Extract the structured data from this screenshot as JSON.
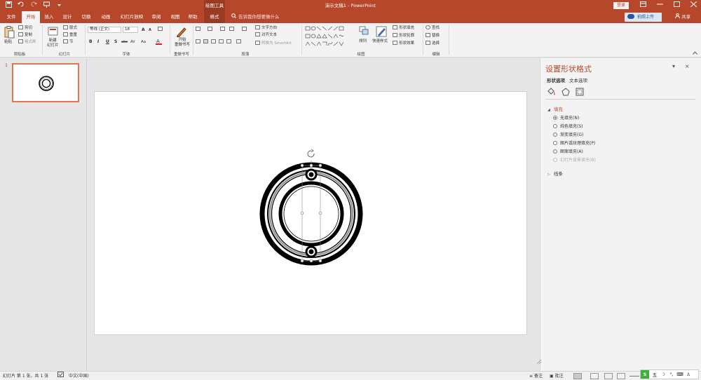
{
  "title_bar": {
    "document_title": "演示文稿1  -  PowerPoint",
    "context_group": "绘图工具",
    "login_button": "登录",
    "qat_icons": [
      "save-icon",
      "undo-icon",
      "redo-icon",
      "start-from-beginning-icon",
      "customize-qat-icon"
    ],
    "window_controls": [
      "ribbon-display-icon",
      "minimize-icon",
      "restore-icon",
      "close-icon"
    ]
  },
  "tabs": [
    {
      "label": "文件"
    },
    {
      "label": "开始"
    },
    {
      "label": "插入"
    },
    {
      "label": "设计"
    },
    {
      "label": "切换"
    },
    {
      "label": "动画"
    },
    {
      "label": "幻灯片放映"
    },
    {
      "label": "审阅"
    },
    {
      "label": "视图"
    },
    {
      "label": "帮助"
    },
    {
      "label": "格式"
    }
  ],
  "tell_me": "告诉我你想要做什么",
  "upload_button": "拍照上传",
  "share_button": "共享",
  "ribbon": {
    "clipboard": {
      "paste": "粘贴",
      "cut": "剪切",
      "copy": "复制",
      "format_painter": "格式刷",
      "label": "剪贴板"
    },
    "slides": {
      "new_slide": "新建\n幻灯片",
      "layout": "版式",
      "reset": "重置",
      "section": "节",
      "label": "幻灯片"
    },
    "font": {
      "font_name": "等线 (正文)",
      "font_size": "18",
      "label": "字体",
      "bold": "B",
      "italic": "I",
      "underline": "U",
      "shadow": "S",
      "strikethrough": "abc",
      "spacing": "AV",
      "case": "Aa",
      "grow": "A",
      "shrink": "A"
    },
    "painter": {
      "label_btn": "开始\n重做书写",
      "label": "重做书写"
    },
    "paragraph": {
      "text_direction": "文字方向",
      "align_text": "对齐文本",
      "smartart": "转换为 SmartArt",
      "label": "段落"
    },
    "drawing": {
      "arrange": "排列",
      "quick_styles": "快速样式",
      "shape_fill": "形状填充",
      "shape_outline": "形状轮廓",
      "shape_effects": "形状效果",
      "label": "绘图"
    },
    "editing": {
      "find": "查找",
      "replace": "替换",
      "select": "选择",
      "label": "编辑"
    }
  },
  "slide_panel": {
    "slide_number": "1"
  },
  "format_pane": {
    "title": "设置形状格式",
    "tabs": [
      "形状选项",
      "文本选项"
    ],
    "fill_section": "填充",
    "fill_options": [
      {
        "label": "无填充(N)",
        "selected": true,
        "disabled": false
      },
      {
        "label": "纯色填充(S)",
        "selected": false,
        "disabled": false
      },
      {
        "label": "渐变填充(G)",
        "selected": false,
        "disabled": false
      },
      {
        "label": "图片或纹理填充(P)",
        "selected": false,
        "disabled": false
      },
      {
        "label": "图案填充(A)",
        "selected": false,
        "disabled": false
      },
      {
        "label": "幻灯片背景填充(B)",
        "selected": false,
        "disabled": true
      }
    ],
    "line_section": "线条"
  },
  "status_bar": {
    "slide_info": "幻灯片 第 1 张，共 1 张",
    "language": "中文(中国)",
    "notes": "备注",
    "comments": "批注"
  },
  "ime": {
    "logo": "S",
    "mode": "五"
  },
  "colors": {
    "accent": "#b7472a",
    "ribbon_bg": "#f3f3f3",
    "workspace": "#e6e6e6"
  }
}
